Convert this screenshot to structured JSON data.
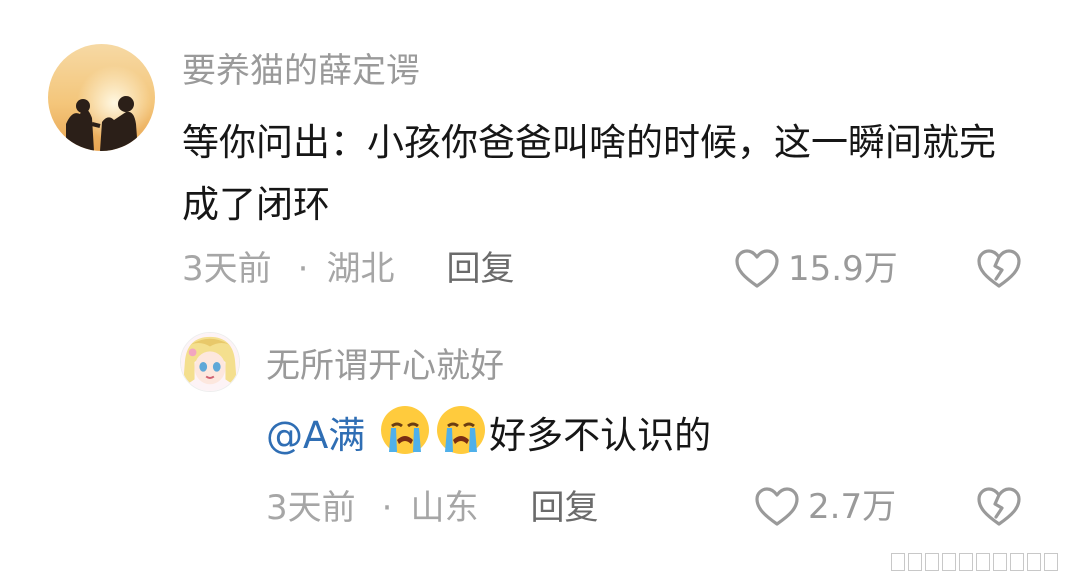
{
  "comments": [
    {
      "username": "要养猫的薛定谔",
      "text": "等你问出：小孩你爸爸叫啥的时候，这一瞬间就完成了闭环",
      "time": "3天前",
      "dot": "·",
      "location": "湖北",
      "reply_label": "回复",
      "likes": "15.9万"
    },
    {
      "username": "无所谓开心就好",
      "mention": "@A满",
      "text": "好多不认识的",
      "time": "3天前",
      "dot": "·",
      "location": "山东",
      "reply_label": "回复",
      "likes": "2.7万"
    }
  ],
  "icons": {
    "like": "heart-outline-icon",
    "dislike": "broken-heart-icon",
    "emoji": "loudly-crying-face-emoji"
  },
  "colors": {
    "username": "#9a9a9a",
    "text": "#161616",
    "mention": "#2f6eb4",
    "meta": "#a6a6a6"
  }
}
